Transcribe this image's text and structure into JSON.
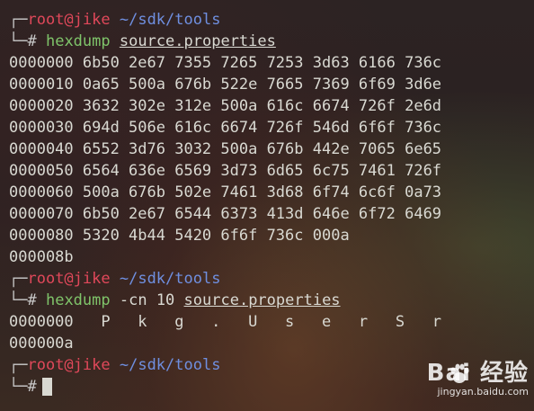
{
  "prompt": {
    "frame_top": "┌─",
    "frame_bottom": "└─#",
    "user": "root@jike",
    "path": "~/sdk/tools"
  },
  "commands": [
    {
      "name": "hexdump",
      "options": "",
      "arg": "source.properties"
    },
    {
      "name": "hexdump",
      "options": "-cn 10",
      "arg": "source.properties"
    }
  ],
  "hexdump_output": [
    "0000000 6b50 2e67 7355 7265 7253 3d63 6166 736c",
    "0000010 0a65 500a 676b 522e 7665 7369 6f69 3d6e",
    "0000020 3632 302e 312e 500a 616c 6674 726f 2e6d",
    "0000030 694d 506e 616c 6674 726f 546d 6f6f 736c",
    "0000040 6552 3d76 3032 500a 676b 442e 7065 6e65",
    "0000050 6564 636e 6569 3d73 6d65 6c75 7461 726f",
    "0000060 500a 676b 502e 7461 3d68 6f74 6c6f 0a73",
    "0000070 6b50 2e67 6544 6373 413d 646e 6f72 6469",
    "0000080 5320 4b44 5420 6f6f 736c 000a",
    "000008b"
  ],
  "char_output": [
    "0000000   P   k   g   .   U   s   e   r   S   r",
    "000000a"
  ],
  "watermark": {
    "brand": "Bai  经验",
    "url": "jingyan.baidu.com",
    "icon": "baidu-paw-icon"
  }
}
